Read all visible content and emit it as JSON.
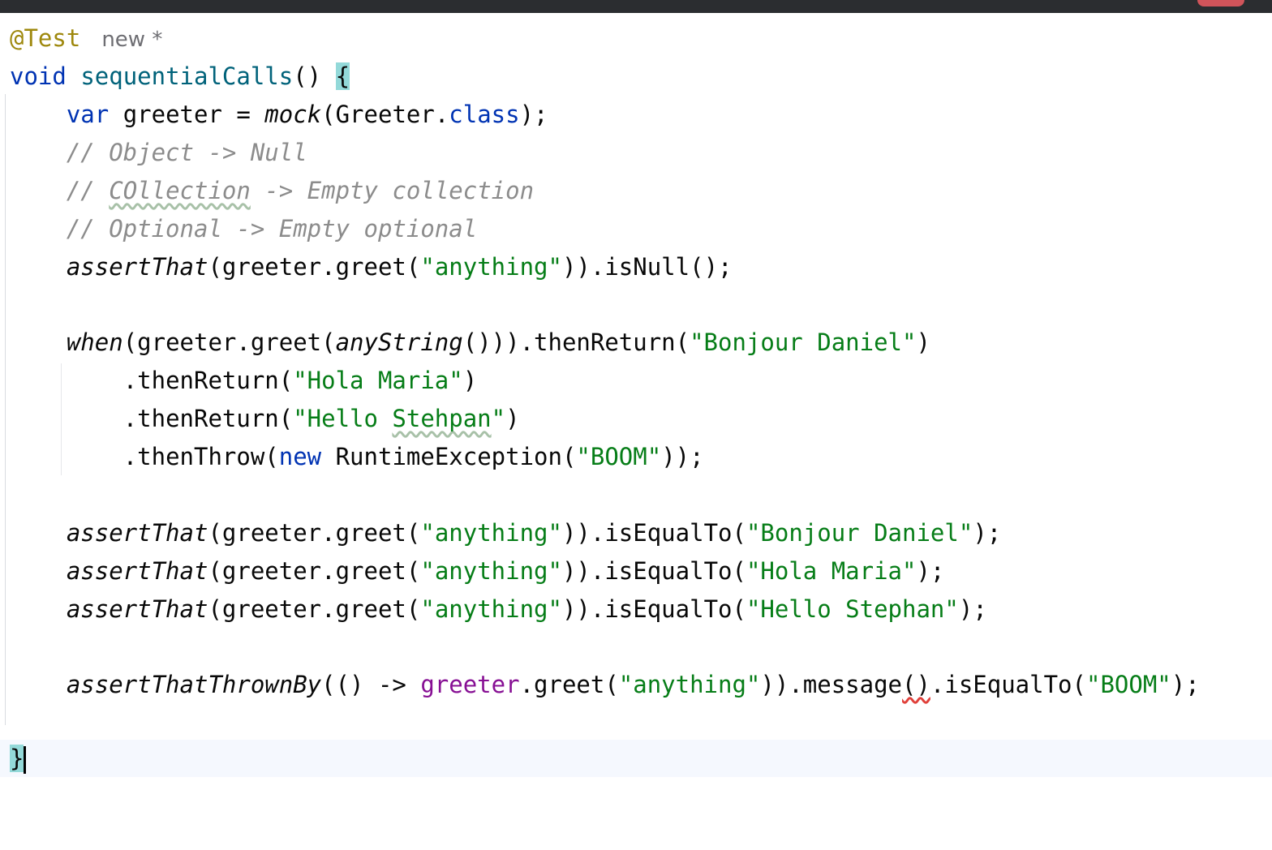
{
  "colors": {
    "annotation": "#9e880d",
    "keyword": "#0033b3",
    "method_declaration": "#00627a",
    "comment": "#8c8c8c",
    "string": "#067d17",
    "field": "#871094",
    "brace_highlight": "#93d9d9",
    "error_underline": "#e0403a"
  },
  "editor": {
    "annotation": "@Test",
    "usage_hint": "new *",
    "lines": [
      {
        "kw": "void",
        "method": "sequentialCalls",
        "rest": "() ",
        "brace": "{"
      },
      {
        "kw": "var",
        "a": " greeter = ",
        "fn": "mock",
        "b": "(Greeter.",
        "kw2": "class",
        "c": ");"
      },
      {
        "comment": "// Object -> Null"
      },
      {
        "pre": "// ",
        "typo": "COllection",
        "post": " -> Empty collection"
      },
      {
        "comment": "// Optional -> Empty optional"
      },
      {
        "fn": "assertThat",
        "a": "(greeter.greet(",
        "s": "\"anything\"",
        "b": ")).isNull();"
      },
      {
        "fn": "when",
        "a": "(greeter.greet(",
        "fn2": "anyString",
        "b": "())).thenReturn(",
        "s": "\"Bonjour Daniel\"",
        "c": ")"
      },
      {
        "a": ".thenReturn(",
        "s": "\"Hola Maria\"",
        "b": ")"
      },
      {
        "a": ".thenReturn(",
        "s1": "\"Hello ",
        "typo": "Stehpan",
        "s2": "\"",
        "b": ")"
      },
      {
        "a": ".thenThrow(",
        "kw": "new",
        "b": " RuntimeException(",
        "s": "\"BOOM\"",
        "c": "));"
      },
      {
        "fn": "assertThat",
        "a": "(greeter.greet(",
        "s": "\"anything\"",
        "b": ")).isEqualTo(",
        "s2": "\"Bonjour Daniel\"",
        "c": ");"
      },
      {
        "fn": "assertThat",
        "a": "(greeter.greet(",
        "s": "\"anything\"",
        "b": ")).isEqualTo(",
        "s2": "\"Hola Maria\"",
        "c": ");"
      },
      {
        "fn": "assertThat",
        "a": "(greeter.greet(",
        "s": "\"anything\"",
        "b": ")).isEqualTo(",
        "s2": "\"Hello Stephan\"",
        "c": ");"
      },
      {
        "fn": "assertThatThrownBy",
        "a": "(() -> ",
        "field": "greeter",
        "b": ".greet(",
        "s": "\"anything\"",
        "c": ")).message",
        "err": "()",
        "d": ".isEqualTo(",
        "s2": "\"BOOM\"",
        "e": ");"
      },
      {
        "brace": "}"
      }
    ]
  }
}
